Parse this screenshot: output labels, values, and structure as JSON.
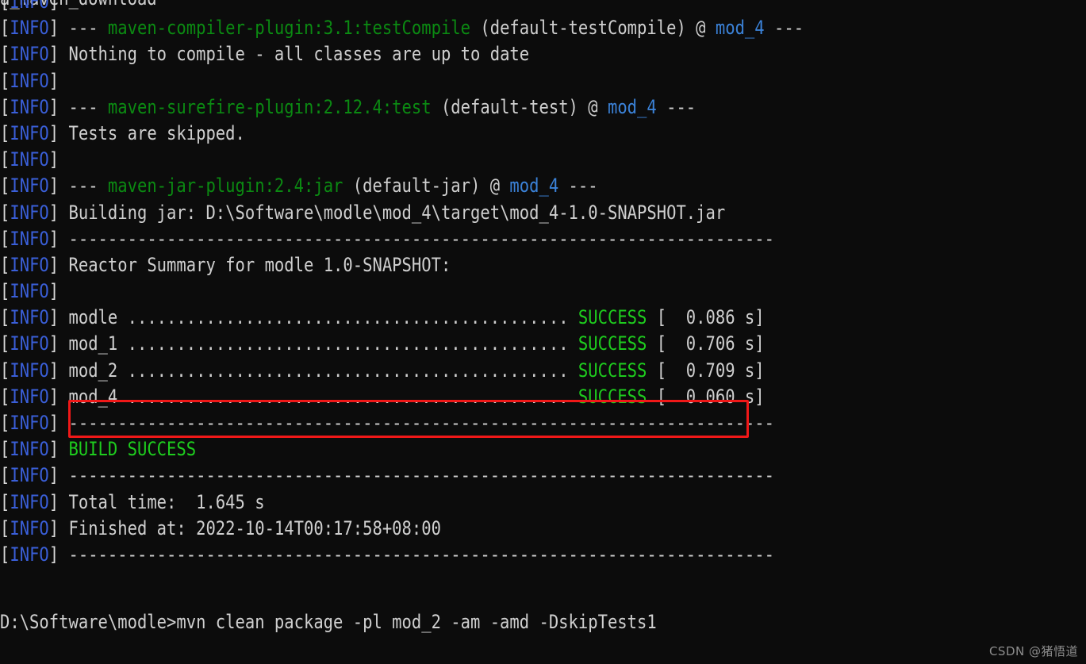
{
  "terminal": {
    "background_color": "#0c0c0c",
    "colors": {
      "info_tag": "#3a5fd9",
      "bracket": "#d8d8d8",
      "plain_text": "#cfcfcf",
      "plugin_green": "#0b8a12",
      "success_green": "#1ecd1e",
      "module_blue": "#3b82d8",
      "highlight_box": "#f01818",
      "watermark": "#8d8d8d"
    },
    "clipped_top_line": "a_maven_download",
    "info_tag_open": "[",
    "info_tag_label": "INFO",
    "info_tag_close": "]",
    "separator": "------------------------------------------------------------------------",
    "lines": [
      {
        "tag": "INFO",
        "text": ""
      },
      {
        "tag": "INFO",
        "segments": [
          {
            "t": " --- ",
            "c": "plain"
          },
          {
            "t": "maven-compiler-plugin:3.1:testCompile",
            "c": "plugin"
          },
          {
            "t": " (default-testCompile) @ ",
            "c": "plain"
          },
          {
            "t": "mod_4",
            "c": "mod"
          },
          {
            "t": " ---",
            "c": "plain"
          }
        ]
      },
      {
        "tag": "INFO",
        "text": " Nothing to compile - all classes are up to date"
      },
      {
        "tag": "INFO",
        "text": ""
      },
      {
        "tag": "INFO",
        "segments": [
          {
            "t": " --- ",
            "c": "plain"
          },
          {
            "t": "maven-surefire-plugin:2.12.4:test",
            "c": "plugin"
          },
          {
            "t": " (default-test) @ ",
            "c": "plain"
          },
          {
            "t": "mod_4",
            "c": "mod"
          },
          {
            "t": " ---",
            "c": "plain"
          }
        ]
      },
      {
        "tag": "INFO",
        "text": " Tests are skipped."
      },
      {
        "tag": "INFO",
        "text": ""
      },
      {
        "tag": "INFO",
        "segments": [
          {
            "t": " --- ",
            "c": "plain"
          },
          {
            "t": "maven-jar-plugin:2.4:jar",
            "c": "plugin"
          },
          {
            "t": " (default-jar) @ ",
            "c": "plain"
          },
          {
            "t": "mod_4",
            "c": "mod"
          },
          {
            "t": " ---",
            "c": "plain"
          }
        ]
      },
      {
        "tag": "INFO",
        "text": " Building jar: D:\\Software\\modle\\mod_4\\target\\mod_4-1.0-SNAPSHOT.jar"
      },
      {
        "tag": "INFO",
        "text": " ------------------------------------------------------------------------"
      },
      {
        "tag": "INFO",
        "text": " Reactor Summary for modle 1.0-SNAPSHOT:"
      },
      {
        "tag": "INFO",
        "text": ""
      },
      {
        "tag": "INFO",
        "segments": [
          {
            "t": " modle ............................................. ",
            "c": "plain"
          },
          {
            "t": "SUCCESS",
            "c": "ok"
          },
          {
            "t": " [  0.086 s]",
            "c": "plain"
          }
        ]
      },
      {
        "tag": "INFO",
        "segments": [
          {
            "t": " mod_1 ............................................. ",
            "c": "plain"
          },
          {
            "t": "SUCCESS",
            "c": "ok"
          },
          {
            "t": " [  0.706 s]",
            "c": "plain"
          }
        ]
      },
      {
        "tag": "INFO",
        "segments": [
          {
            "t": " mod_2 ............................................. ",
            "c": "plain"
          },
          {
            "t": "SUCCESS",
            "c": "ok"
          },
          {
            "t": " [  0.709 s]",
            "c": "plain"
          }
        ]
      },
      {
        "tag": "INFO",
        "segments": [
          {
            "t": " mod_4 ............................................. ",
            "c": "plain"
          },
          {
            "t": "SUCCESS",
            "c": "ok"
          },
          {
            "t": " [  0.060 s]",
            "c": "plain"
          }
        ]
      },
      {
        "tag": "INFO",
        "text": " ------------------------------------------------------------------------"
      },
      {
        "tag": "INFO",
        "segments": [
          {
            "t": " ",
            "c": "plain"
          },
          {
            "t": "BUILD SUCCESS",
            "c": "ok"
          }
        ]
      },
      {
        "tag": "INFO",
        "text": " ------------------------------------------------------------------------"
      },
      {
        "tag": "INFO",
        "text": " Total time:  1.645 s"
      },
      {
        "tag": "INFO",
        "text": " Finished at: 2022-10-14T00:17:58+08:00"
      },
      {
        "tag": "INFO",
        "text": " ------------------------------------------------------------------------"
      }
    ],
    "prompt": {
      "path": "D:\\Software\\modle>",
      "command": "mvn clean package -pl mod_2 -am -amd -DskipTests1",
      "full": "D:\\Software\\modle>mvn clean package -pl mod_2 -am -amd -DskipTests1"
    },
    "highlight": {
      "label": "mod_4-reactor-row-highlight",
      "target_row": "mod_4"
    }
  },
  "watermark": {
    "text": "CSDN @猪悟道"
  }
}
